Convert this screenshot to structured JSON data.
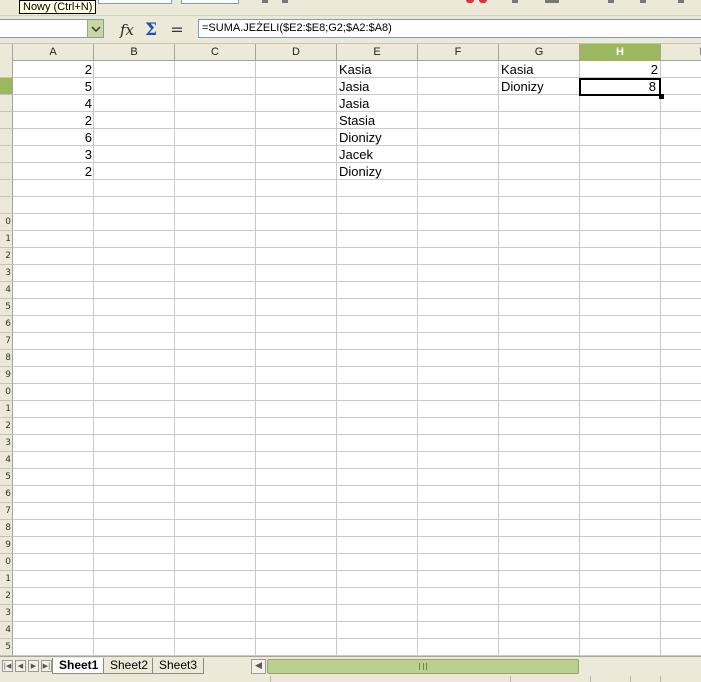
{
  "tooltip": "Nowy (Ctrl+N)",
  "formula_bar": {
    "name_box": "",
    "formula": "=SUMA.JEŻELI($E2:$E8;G2;$A2:$A8)",
    "function_wizard_icon": "fx-icon",
    "sum_icon": "sigma-icon",
    "equals_icon": "equals-icon"
  },
  "columns": [
    "A",
    "B",
    "C",
    "D",
    "E",
    "F",
    "G",
    "H",
    "I"
  ],
  "selected_column": "H",
  "rows": {
    "row1": {
      "a": "2",
      "e": "Kasia",
      "g": "Kasia",
      "h": "2"
    },
    "row2": {
      "a": "5",
      "e": "Jasia",
      "g": "Dionizy",
      "h": "8"
    },
    "row3": {
      "a": "4",
      "e": "Jasia"
    },
    "row4": {
      "a": "2",
      "e": "Stasia"
    },
    "row5": {
      "a": "6",
      "e": "Dionizy"
    },
    "row6": {
      "a": "3",
      "e": "Jacek"
    },
    "row7": {
      "a": "2",
      "e": "Dionizy"
    }
  },
  "row_numbers": [
    "",
    "",
    "",
    "",
    "",
    "",
    "",
    "",
    "",
    "0",
    "1",
    "2",
    "3",
    "4",
    "5",
    "6",
    "7",
    "8",
    "9",
    "0",
    "1",
    "2",
    "3",
    "4",
    "5",
    "6",
    "7",
    "8",
    "9",
    "0",
    "1",
    "2",
    "3",
    "4",
    "5"
  ],
  "sheet_tabs": [
    "Sheet1",
    "Sheet2",
    "Sheet3"
  ],
  "active_sheet": "Sheet1",
  "colors": {
    "selection_header": "#9cb85e",
    "scrollbar_thumb": "#b9d08e",
    "chrome": "#ece9d8"
  }
}
